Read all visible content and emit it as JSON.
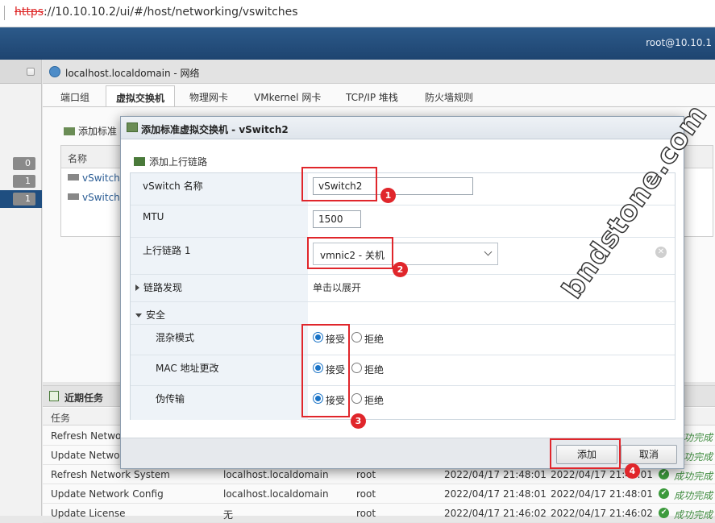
{
  "browser": {
    "url_proto": "https",
    "url_rest": "://10.10.10.2/ui/#/host/networking/vswitches"
  },
  "topbar": {
    "user": "root@10.10.1"
  },
  "leftnav": {
    "badges": [
      "0",
      "1",
      "1"
    ]
  },
  "main": {
    "title": "localhost.localdomain - 网络",
    "tabs": [
      "端口组",
      "虚拟交换机",
      "物理网卡",
      "VMkernel 网卡",
      "TCP/IP 堆栈",
      "防火墙规则"
    ],
    "add_button": "添加标准",
    "grid": {
      "header": "名称",
      "rows": [
        "vSwitch0",
        "vSwitch1"
      ]
    }
  },
  "tasks": {
    "title": "近期任务",
    "col_task": "任务",
    "rows": [
      {
        "task": "Refresh Network",
        "target": "",
        "user": "",
        "queued": "",
        "started": "",
        "result": "成功完成"
      },
      {
        "task": "Update Network",
        "target": "",
        "user": "",
        "queued": "",
        "started": "",
        "result": "成功完成"
      },
      {
        "task": "Refresh Network System",
        "target": "localhost.localdomain",
        "user": "root",
        "queued": "2022/04/17 21:48:01",
        "started": "2022/04/17 21:48:01",
        "result": "成功完成"
      },
      {
        "task": "Update Network Config",
        "target": "localhost.localdomain",
        "user": "root",
        "queued": "2022/04/17 21:48:01",
        "started": "2022/04/17 21:48:01",
        "result": "成功完成"
      },
      {
        "task": "Update License",
        "target": "无",
        "user": "root",
        "queued": "2022/04/17 21:46:02",
        "started": "2022/04/17 21:46:02",
        "result": "成功完成"
      }
    ]
  },
  "modal": {
    "title": "添加标准虚拟交换机 - vSwitch2",
    "add_uplink": "添加上行链路",
    "fields": {
      "vswitch_name_label": "vSwitch 名称",
      "vswitch_name_value": "vSwitch2",
      "mtu_label": "MTU",
      "mtu_value": "1500",
      "uplink1_label": "上行链路 1",
      "uplink1_value": "vmnic2 - 关机",
      "link_discovery_label": "链路发现",
      "link_discovery_value": "单击以展开",
      "security_label": "安全",
      "promiscuous_label": "混杂模式",
      "mac_change_label": "MAC 地址更改",
      "forged_label": "伪传输",
      "accept": "接受",
      "reject": "拒绝"
    },
    "buttons": {
      "add": "添加",
      "cancel": "取消"
    }
  },
  "annotations": [
    "1",
    "2",
    "3",
    "4"
  ],
  "watermark": "bndstone.com",
  "colors": {
    "accent": "#1a73c6",
    "annotation": "#e0262b",
    "topbar": "#24507e",
    "success": "#3c8a3c"
  },
  "icons": [
    "globe-icon",
    "vswitch-icon",
    "uplink-icon",
    "tasks-icon",
    "check-icon",
    "chevron-down-icon",
    "clear-icon"
  ]
}
